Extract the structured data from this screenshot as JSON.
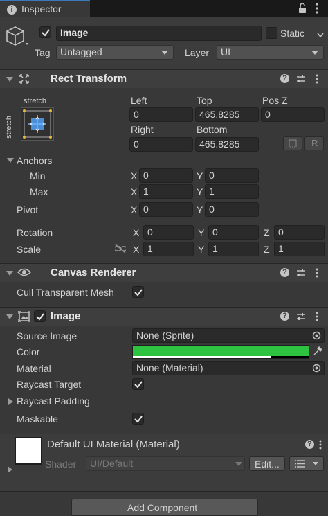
{
  "tab": {
    "title": "Inspector"
  },
  "header": {
    "name_value": "Image",
    "static_label": "Static",
    "tag_label": "Tag",
    "tag_value": "Untagged",
    "layer_label": "Layer",
    "layer_value": "UI"
  },
  "rect_transform": {
    "title": "Rect Transform",
    "anchor_preset_top": "stretch",
    "anchor_preset_side": "stretch",
    "left_label": "Left",
    "left_value": "0",
    "top_label": "Top",
    "top_value": "465.8285",
    "posz_label": "Pos Z",
    "posz_value": "0",
    "right_label": "Right",
    "right_value": "0",
    "bottom_label": "Bottom",
    "bottom_value": "465.8285",
    "raw_button": "R",
    "anchors_label": "Anchors",
    "min_label": "Min",
    "min_x": "0",
    "min_y": "0",
    "max_label": "Max",
    "max_x": "1",
    "max_y": "1",
    "pivot_label": "Pivot",
    "pivot_x": "0",
    "pivot_y": "0",
    "rotation_label": "Rotation",
    "rot_x": "0",
    "rot_y": "0",
    "rot_z": "0",
    "scale_label": "Scale",
    "scale_x": "1",
    "scale_y": "1",
    "scale_z": "1",
    "axis_x": "X",
    "axis_y": "Y",
    "axis_z": "Z"
  },
  "canvas_renderer": {
    "title": "Canvas Renderer",
    "cull_label": "Cull Transparent Mesh",
    "cull_checked": true
  },
  "image": {
    "title": "Image",
    "source_label": "Source Image",
    "source_value": "None (Sprite)",
    "color_label": "Color",
    "color_value": "#2dc240",
    "material_label": "Material",
    "material_value": "None (Material)",
    "raycast_target_label": "Raycast Target",
    "raycast_padding_label": "Raycast Padding",
    "maskable_label": "Maskable"
  },
  "material_preview": {
    "title": "Default UI Material (Material)",
    "shader_label": "Shader",
    "shader_value": "UI/Default",
    "edit_button": "Edit..."
  },
  "add_component": {
    "label": "Add Component"
  },
  "colors": {
    "accent_green": "#2dc240",
    "panel": "#383838",
    "header": "#3e3e3e"
  }
}
